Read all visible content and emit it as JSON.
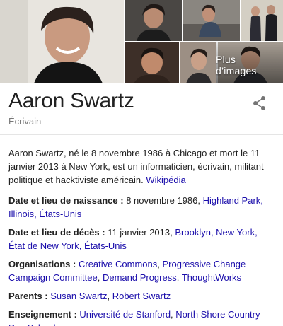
{
  "images": {
    "more_label": "Plus d’images"
  },
  "entity": {
    "name": "Aaron Swartz",
    "type": "Écrivain"
  },
  "description": {
    "text": "Aaron Swartz, né le 8 novembre 1986 à Chicago et mort le 11 janvier 2013 à New York, est un informaticien, écrivain, militant politique et hacktiviste américain.",
    "source_link": "Wikipédia"
  },
  "facts": {
    "birth": {
      "label": "Date et lieu de naissance :",
      "value": "8 novembre 1986,",
      "links": [
        "Highland Park, Illinois, États-Unis"
      ]
    },
    "death": {
      "label": "Date et lieu de décès :",
      "value": "11 janvier 2013,",
      "links": [
        "Brooklyn, New York, État de New York, États-Unis"
      ]
    },
    "organisations": {
      "label": "Organisations :",
      "links": [
        "Creative Commons",
        "Progressive Change Campaign Committee",
        "Demand Progress",
        "ThoughtWorks"
      ]
    },
    "parents": {
      "label": "Parents :",
      "links": [
        "Susan Swartz",
        "Robert Swartz"
      ]
    },
    "education": {
      "label": "Enseignement :",
      "links": [
        "Université de Stanford",
        "North Shore Country Day School"
      ]
    }
  },
  "colors": {
    "link": "#1a0dab",
    "text": "#222222",
    "subtle": "#777777"
  },
  "icons": [
    "share-icon"
  ]
}
